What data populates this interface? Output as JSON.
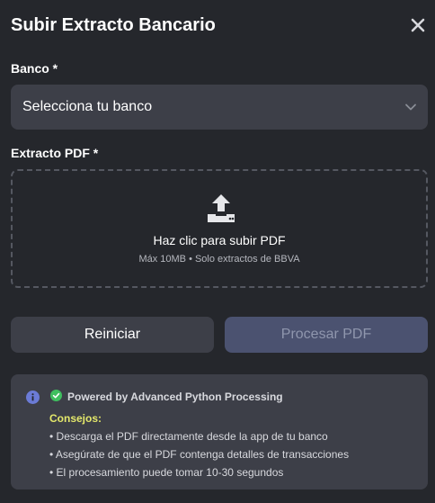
{
  "modal": {
    "title": "Subir Extracto Bancario",
    "close_icon": "close-icon"
  },
  "bank": {
    "label": "Banco *",
    "select_value": "Selecciona tu banco",
    "chevron_icon": "chevron-down-icon"
  },
  "pdf": {
    "label": "Extracto PDF *",
    "upload_icon": "upload-icon",
    "dropzone_title": "Haz clic para subir PDF",
    "dropzone_subtitle": "Máx 10MB • Solo extractos de BBVA"
  },
  "buttons": {
    "reset_label": "Reiniciar",
    "process_label": "Procesar PDF"
  },
  "info": {
    "info_icon": "info-icon",
    "check_icon": "check-circle-icon",
    "powered": "Powered by Advanced Python Processing",
    "tips_title": "Consejos:",
    "tips": [
      "• Descarga el PDF directamente desde la app de tu banco",
      "• Asegúrate de que el PDF contenga detalles de transacciones",
      "• El procesamiento puede tomar 10-30 segundos"
    ]
  },
  "colors": {
    "background": "#25272c",
    "field": "#3d3f48",
    "process_button": "#4b5270",
    "tips_accent": "#e4e86b",
    "success": "#3fbf5f",
    "info": "#6b7bd6"
  }
}
